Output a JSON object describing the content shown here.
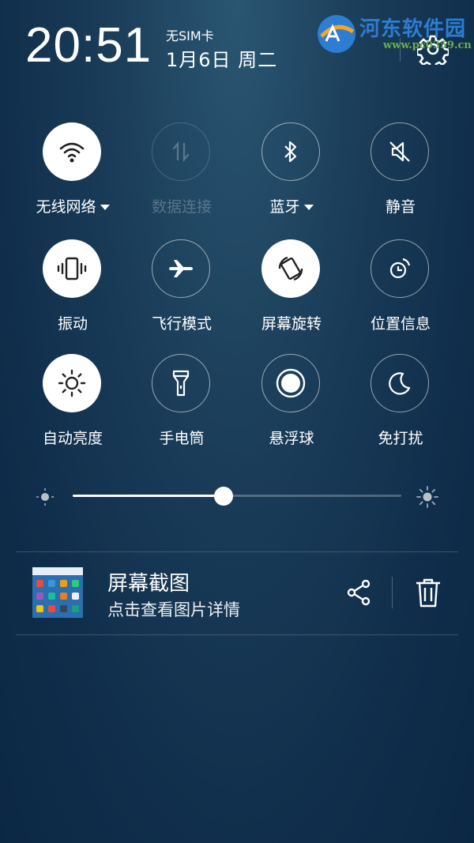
{
  "status": {
    "time": "20:51",
    "sim": "无SIM卡",
    "date": "1月6日 周二"
  },
  "watermark": {
    "title": "河东软件园",
    "url": "www.pc0359.cn"
  },
  "toggles": [
    {
      "label": "无线网络",
      "icon": "wifi-icon",
      "state": "on",
      "has_menu": true
    },
    {
      "label": "数据连接",
      "icon": "data-arrows-icon",
      "state": "disabled",
      "has_menu": false
    },
    {
      "label": "蓝牙",
      "icon": "bluetooth-icon",
      "state": "off",
      "has_menu": true
    },
    {
      "label": "静音",
      "icon": "mute-icon",
      "state": "off",
      "has_menu": false
    },
    {
      "label": "振动",
      "icon": "vibrate-icon",
      "state": "on",
      "has_menu": false
    },
    {
      "label": "飞行模式",
      "icon": "airplane-icon",
      "state": "off",
      "has_menu": false
    },
    {
      "label": "屏幕旋转",
      "icon": "rotate-icon",
      "state": "on",
      "has_menu": false
    },
    {
      "label": "位置信息",
      "icon": "location-icon",
      "state": "off",
      "has_menu": false
    },
    {
      "label": "自动亮度",
      "icon": "brightness-icon",
      "state": "on",
      "has_menu": false
    },
    {
      "label": "手电筒",
      "icon": "flashlight-icon",
      "state": "off",
      "has_menu": false
    },
    {
      "label": "悬浮球",
      "icon": "floating-ball-icon",
      "state": "off",
      "has_menu": false
    },
    {
      "label": "免打扰",
      "icon": "moon-icon",
      "state": "off",
      "has_menu": false
    }
  ],
  "brightness": {
    "level": 0.46
  },
  "notification": {
    "title": "屏幕截图",
    "subtitle": "点击查看图片详情",
    "share_icon": "share-icon",
    "delete_icon": "trash-icon"
  },
  "colors": {
    "background": "#123452",
    "accent": "#ffffff",
    "watermark_blue": "#2d7dd2",
    "watermark_green": "#6ab04c"
  }
}
